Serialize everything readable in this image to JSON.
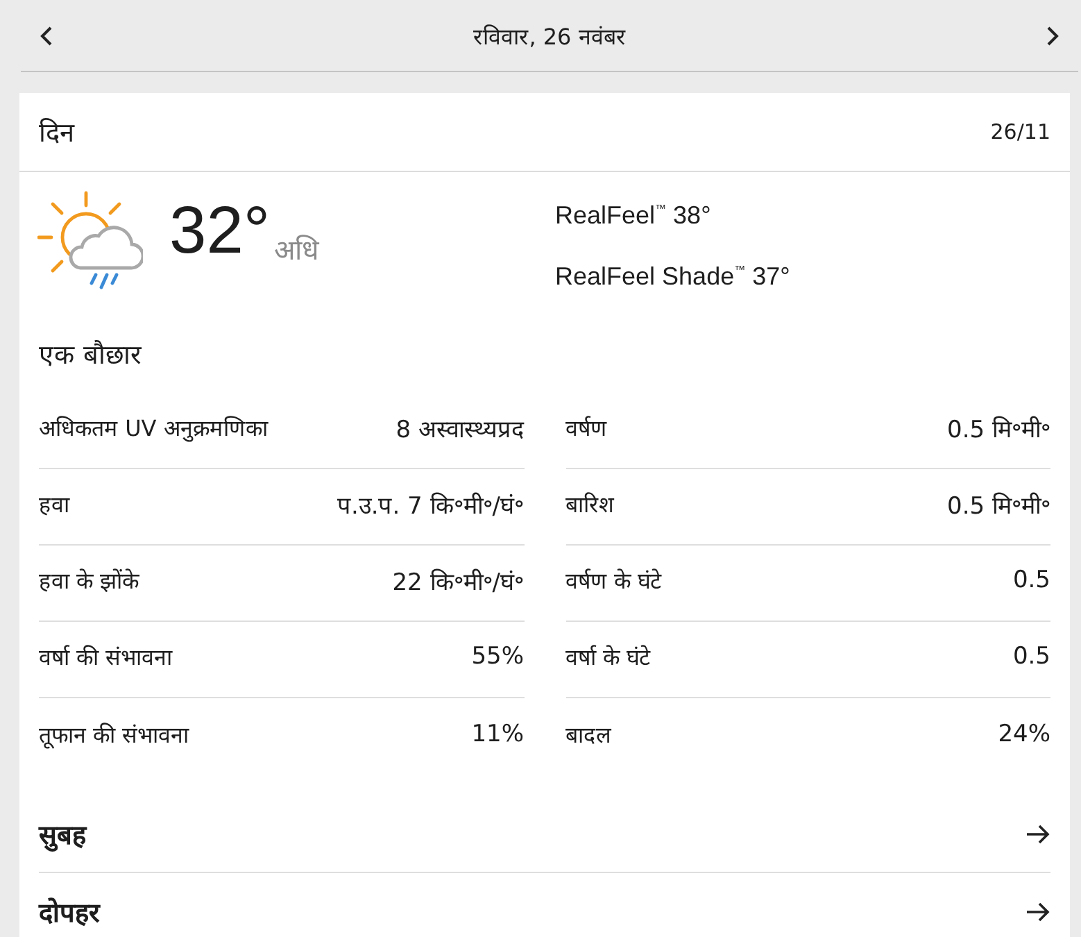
{
  "header": {
    "title": "रविवार, 26 नवंबर"
  },
  "card": {
    "title": "दिन",
    "date": "26/11",
    "current": {
      "temperature": "32°",
      "temperature_label": "अधि",
      "realfeel": [
        "RealFeel$^{™}$ 38°",
        "RealFeel Shade$^{™}$ 37°"
      ],
      "phrase": "एक बौछार"
    },
    "detail_columns": [
      [
        {
          "label": "अधिकतम UV अनुक्रमणिका",
          "value": "8 अस्वास्थ्यप्रद"
        },
        {
          "label": "हवा",
          "value": "प.उ.प. 7 कि॰मी॰/घं॰"
        },
        {
          "label": "हवा के झोंके",
          "value": "22 कि॰मी॰/घं॰"
        },
        {
          "label": "वर्षा की संभावना",
          "value": "55%"
        },
        {
          "label": "तूफान की संभावना",
          "value": "11%"
        }
      ],
      [
        {
          "label": "वर्षण",
          "value": "0.5 मि॰मी॰"
        },
        {
          "label": "बारिश",
          "value": "0.5 मि॰मी॰"
        },
        {
          "label": "वर्षण के घंटे",
          "value": "0.5"
        },
        {
          "label": "वर्षा के घंटे",
          "value": "0.5"
        },
        {
          "label": "बादल",
          "value": "24%"
        }
      ]
    ],
    "sections": [
      {
        "label": "सुबह"
      },
      {
        "label": "दोपहर"
      }
    ]
  }
}
